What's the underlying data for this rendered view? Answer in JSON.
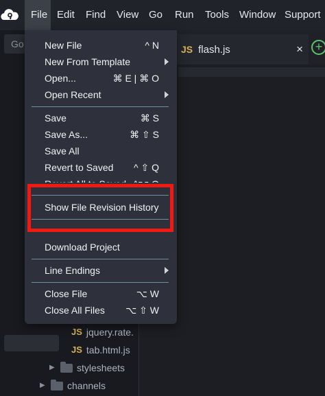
{
  "menubar": {
    "items": [
      {
        "label": "File",
        "active": true
      },
      {
        "label": "Edit"
      },
      {
        "label": "Find"
      },
      {
        "label": "View"
      },
      {
        "label": "Go"
      },
      {
        "label": "Run"
      },
      {
        "label": "Tools"
      },
      {
        "label": "Window"
      },
      {
        "label": "Support"
      }
    ],
    "logo_icon": "cloud9-logo-icon"
  },
  "sidebar": {
    "goto_text": "Go",
    "tree": [
      {
        "type": "file",
        "badge": "JS",
        "label": "jquery.rate."
      },
      {
        "type": "file",
        "badge": "JS",
        "label": "tab.html.js"
      },
      {
        "type": "folder",
        "label": "stylesheets"
      },
      {
        "type": "folder",
        "label": "channels"
      }
    ]
  },
  "editor": {
    "tab": {
      "badge": "JS",
      "label": "flash.js",
      "close": "×"
    },
    "add_tab": "+"
  },
  "file_menu": {
    "items": [
      {
        "label": "New File",
        "shortcut": "^ N"
      },
      {
        "label": "New From Template",
        "submenu": true
      },
      {
        "label": "Open...",
        "shortcut": "⌘ E | ⌘ O"
      },
      {
        "label": "Open Recent",
        "submenu": true
      },
      {
        "label": "Save",
        "shortcut": "⌘ S"
      },
      {
        "label": "Save As...",
        "shortcut": "⌘ ⇧ S"
      },
      {
        "label": "Save All"
      },
      {
        "label": "Revert to Saved",
        "shortcut": "^ ⇧ Q"
      },
      {
        "label": "Revert All to Saved",
        "shortcut": "^⌥ Q"
      },
      {
        "label": "Show File Revision History"
      },
      {
        "label": "Download Project"
      },
      {
        "label": "Line Endings",
        "submenu": true
      },
      {
        "label": "Close File",
        "shortcut": "⌥ W"
      },
      {
        "label": "Close All Files",
        "shortcut": "⌥ ⇧ W"
      }
    ],
    "highlighted_item": "Show File Revision History"
  },
  "colors": {
    "menubar_bg": "#20232a",
    "menu_bg": "#2e313b",
    "highlight_border": "#f21a10",
    "js_badge": "#d8b25a",
    "add_tab": "#5cc46c"
  }
}
